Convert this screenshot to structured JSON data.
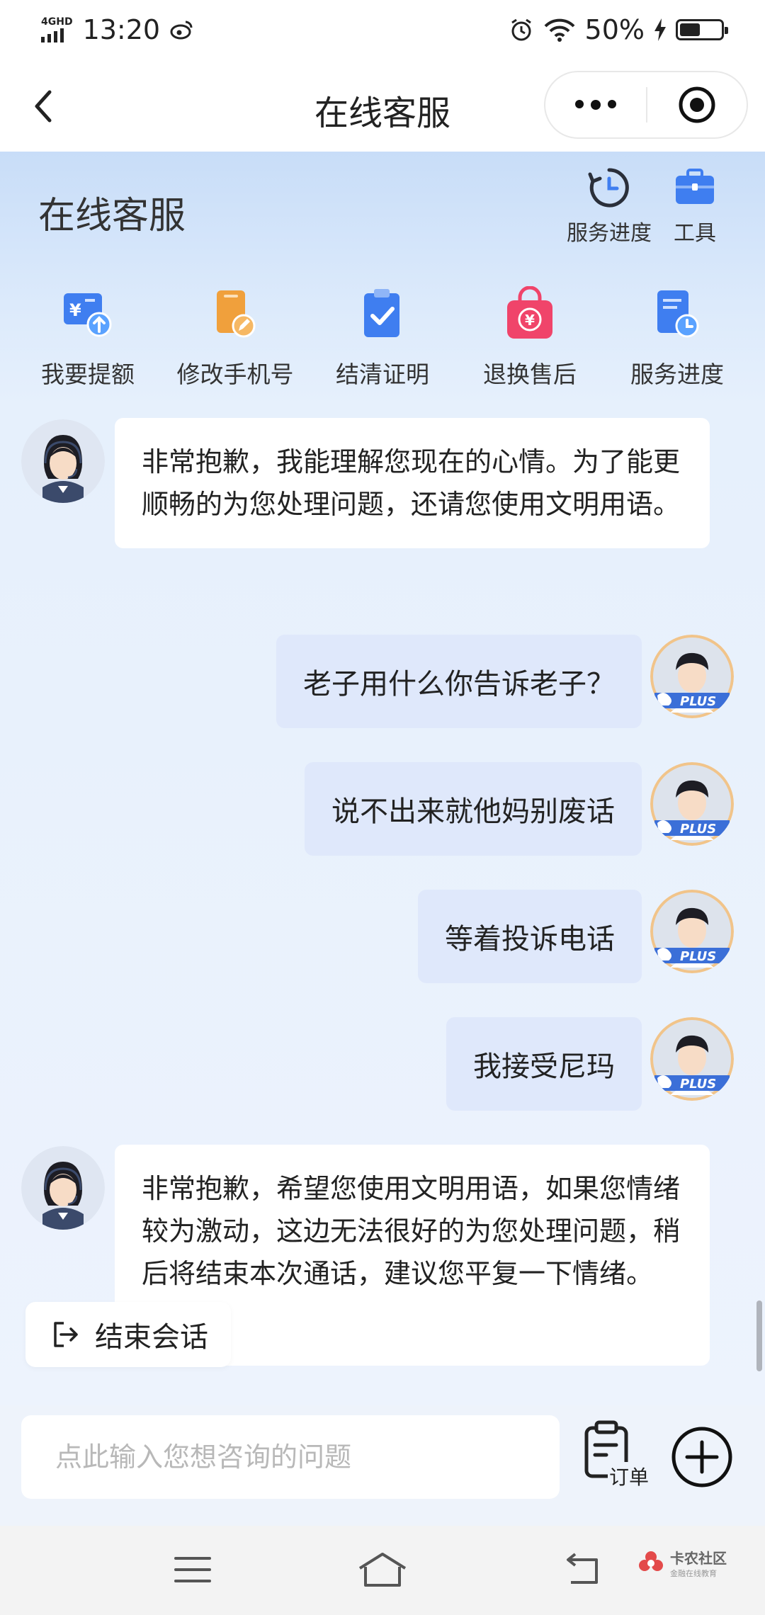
{
  "status_bar": {
    "network": "4GHD",
    "time": "13:20",
    "battery": "50%"
  },
  "nav": {
    "title": "在线客服"
  },
  "header": {
    "title": "在线客服",
    "tools": [
      {
        "label": "服务进度",
        "icon": "clock-icon"
      },
      {
        "label": "工具",
        "icon": "toolbox-icon"
      }
    ],
    "shortcuts": [
      {
        "label": "我要提额",
        "icon": "wallet-up-icon",
        "color": "#3f7ef0"
      },
      {
        "label": "修改手机号",
        "icon": "phone-edit-icon",
        "color": "#f0a03c"
      },
      {
        "label": "结清证明",
        "icon": "clipboard-check-icon",
        "color": "#3f7ef0"
      },
      {
        "label": "退换售后",
        "icon": "shopping-bag-icon",
        "color": "#f0446a"
      },
      {
        "label": "服务进度",
        "icon": "doc-clock-icon",
        "color": "#3f7ef0"
      }
    ]
  },
  "messages": [
    {
      "side": "left",
      "text": "非常抱歉，我能理解您现在的心情。为了能更顺畅的为您处理问题，还请您使用文明用语。"
    },
    {
      "side": "right",
      "text": "老子用什么你告诉老子？",
      "badge": "PLUS"
    },
    {
      "side": "right",
      "text": "说不出来就他妈别废话",
      "badge": "PLUS"
    },
    {
      "side": "right",
      "text": "等着投诉电话",
      "badge": "PLUS"
    },
    {
      "side": "right",
      "text": "我接受尼玛",
      "badge": "PLUS"
    },
    {
      "side": "left",
      "text": "非常抱歉，希望您使用文明用语，如果您情绪较为激动，这边无法很好的为您处理问题，稍后将结束本次通话，建议您平复一下情绪。"
    }
  ],
  "end_session": {
    "label": "结束会话"
  },
  "input": {
    "placeholder": "点此输入您想咨询的问题",
    "value": "",
    "order_label": "订单"
  },
  "watermark": {
    "title": "卡农社区",
    "subtitle": "金融在线教育"
  },
  "colors": {
    "accent": "#3f7ef0",
    "user_bubble": "#dfe8fb",
    "plus_badge": "#3b6fd8"
  }
}
